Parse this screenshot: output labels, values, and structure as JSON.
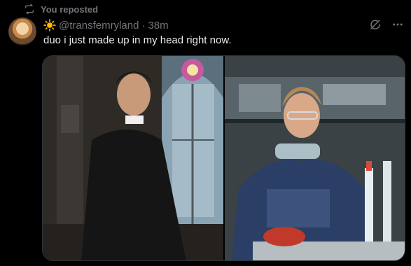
{
  "repost": {
    "label": "You reposted"
  },
  "post": {
    "handle": "@transfemryland",
    "separator": "·",
    "time": "38m",
    "text": "duo i just made up in my head right now."
  },
  "media": {
    "images": [
      {
        "name": "priest-in-church-photo"
      },
      {
        "name": "scientist-in-lab-photo"
      }
    ]
  },
  "icons": {
    "repost": "repost-icon",
    "sun": "sun-emoji-icon",
    "grok": "grok-icon",
    "more": "more-options-icon"
  },
  "colors": {
    "background": "#000000",
    "text": "#e7e9ea",
    "muted": "#71767b",
    "border": "#2f3336",
    "sun": "#ffb900"
  }
}
